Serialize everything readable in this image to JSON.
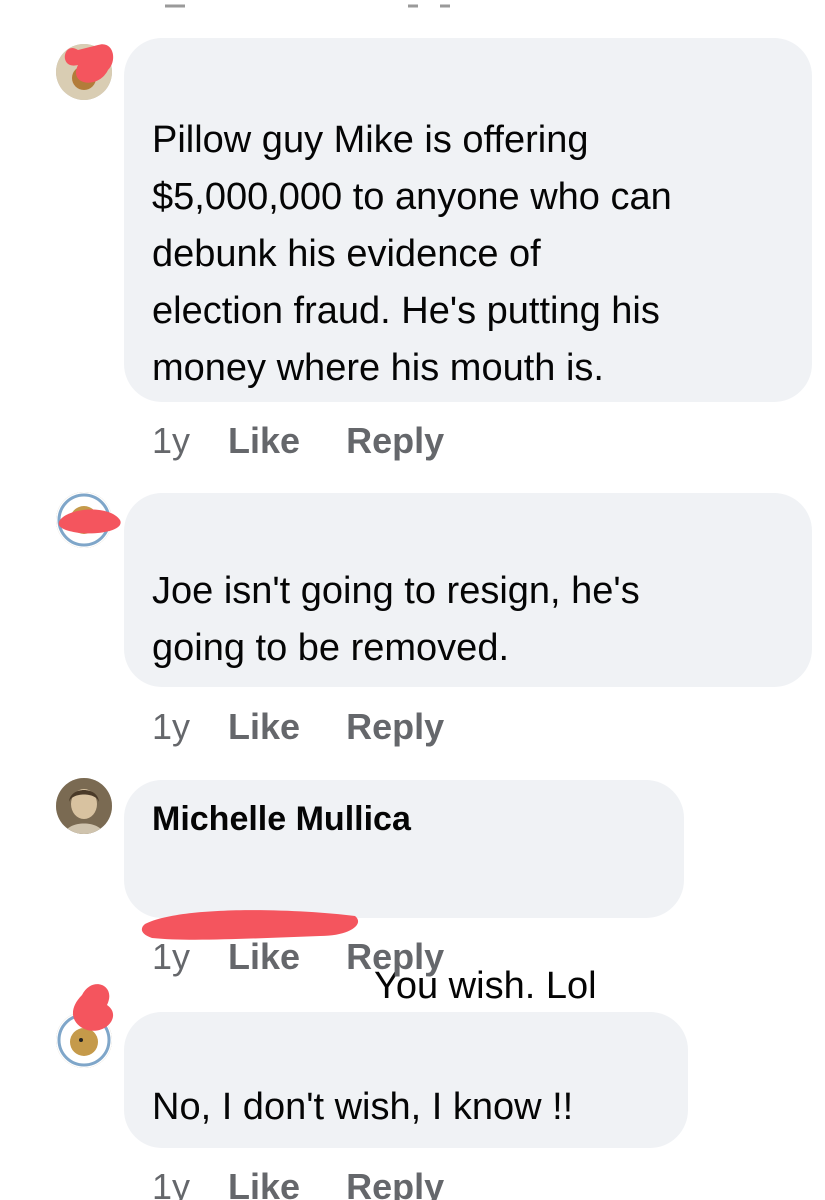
{
  "comments": [
    {
      "author": "",
      "body": "Pillow guy Mike is offering\n$5,000,000 to anyone who can\ndebunk his evidence of\nelection fraud. He's putting his\nmoney where his mouth is.",
      "time": "1y",
      "like_label": "Like",
      "reply_label": "Reply",
      "avatar_icon": "profile-photo-icon"
    },
    {
      "author": "",
      "body": "Joe isn't going to resign, he's\ngoing to be removed.",
      "time": "1y",
      "like_label": "Like",
      "reply_label": "Reply",
      "avatar_icon": "profile-photo-icon"
    },
    {
      "author": "Michelle Mullica",
      "body": "You wish. Lol",
      "time": "1y",
      "like_label": "Like",
      "reply_label": "Reply",
      "avatar_icon": "profile-photo-icon"
    },
    {
      "author": "",
      "body": "No, I don't wish, I know !!",
      "time": "1y",
      "like_label": "Like",
      "reply_label": "Reply",
      "avatar_icon": "profile-photo-icon"
    }
  ],
  "colors": {
    "bubble": "#f0f2f5",
    "text": "#050505",
    "meta": "#65676b",
    "redaction": "#f4555e"
  }
}
